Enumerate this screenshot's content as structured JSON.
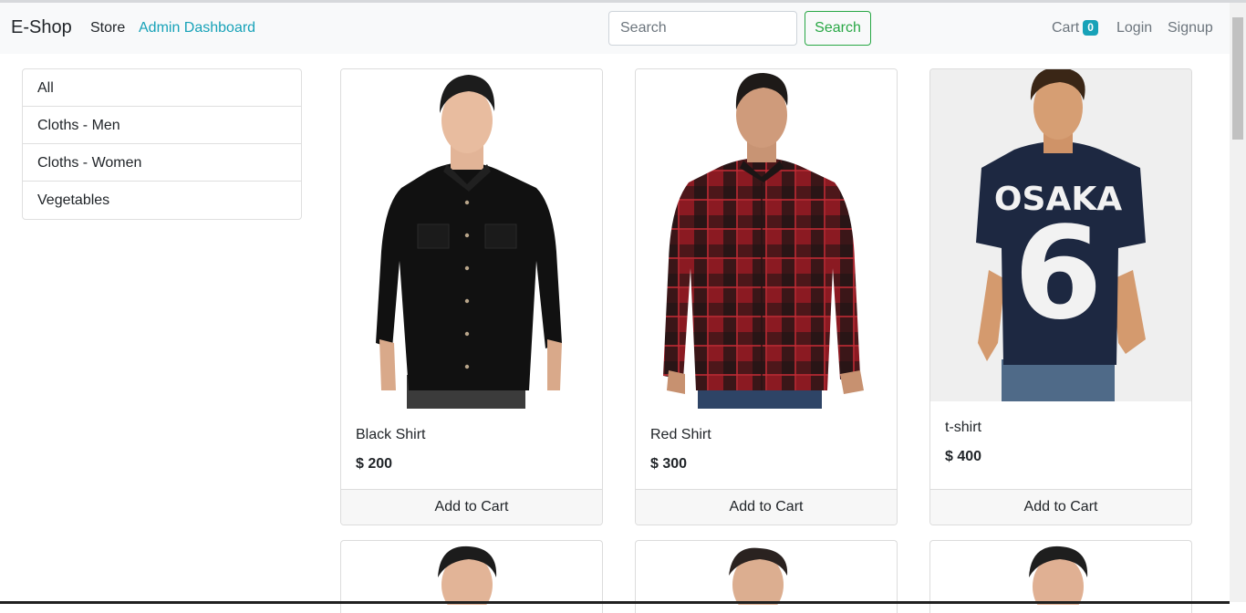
{
  "navbar": {
    "brand": "E-Shop",
    "links": {
      "store": "Store",
      "admin": "Admin Dashboard"
    },
    "search": {
      "placeholder": "Search",
      "value": "",
      "button": "Search"
    },
    "cart": {
      "label": "Cart",
      "count": "0"
    },
    "login": "Login",
    "signup": "Signup"
  },
  "sidebar": {
    "items": [
      {
        "label": "All"
      },
      {
        "label": "Cloths - Men"
      },
      {
        "label": "Cloths - Women"
      },
      {
        "label": "Vegetables"
      }
    ]
  },
  "products": [
    {
      "name": "Black Shirt",
      "price": "$ 200",
      "button": "Add to Cart"
    },
    {
      "name": "Red Shirt",
      "price": "$ 300",
      "button": "Add to Cart"
    },
    {
      "name": "t-shirt",
      "price": "$ 400",
      "button": "Add to Cart"
    }
  ],
  "tshirt_print": {
    "text": "OSAKA",
    "number": "6"
  },
  "colors": {
    "accent_info": "#17a2b8",
    "accent_success": "#28a745",
    "navbar_bg": "#f8f9fa"
  }
}
